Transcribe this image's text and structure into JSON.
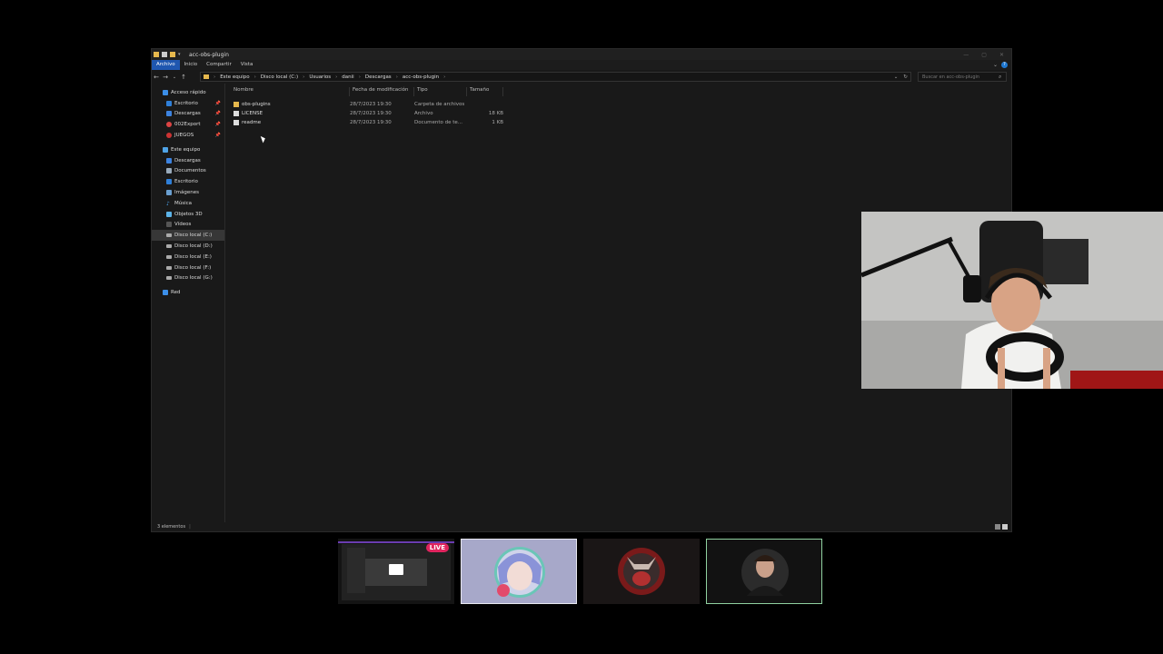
{
  "window": {
    "title": "acc-obs-plugin"
  },
  "ribbon": {
    "tabs": [
      "Archivo",
      "Inicio",
      "Compartir",
      "Vista"
    ]
  },
  "address": {
    "crumbs": [
      "Este equipo",
      "Disco local (C:)",
      "Usuarios",
      "danii",
      "Descargas",
      "acc-obs-plugin"
    ],
    "search_placeholder": "Buscar en acc-obs-plugin"
  },
  "sidebar": {
    "quick_access": "Acceso rápido",
    "quick_items": [
      "Escritorio",
      "Descargas",
      "002Export",
      "JUEGOS"
    ],
    "this_pc": "Este equipo",
    "pc_items": [
      "Descargas",
      "Documentos",
      "Escritorio",
      "Imágenes",
      "Música",
      "Objetos 3D",
      "Vídeos",
      "Disco local (C:)",
      "Disco local (D:)",
      "Disco local (E:)",
      "Disco local (F:)",
      "Disco local (G:)"
    ],
    "network": "Red",
    "selected": "Disco local (C:)"
  },
  "columns": [
    "Nombre",
    "Fecha de modificación",
    "Tipo",
    "Tamaño"
  ],
  "files": [
    {
      "name": "obs-plugins",
      "date": "28/7/2023 19:30",
      "type": "Carpeta de archivos",
      "size": ""
    },
    {
      "name": "LICENSE",
      "date": "28/7/2023 19:30",
      "type": "Archivo",
      "size": "18 KB"
    },
    {
      "name": "readme",
      "date": "28/7/2023 19:30",
      "type": "Documento de te...",
      "size": "1 KB"
    }
  ],
  "status": {
    "count_text": "3 elementos"
  },
  "stream": {
    "live_label": "LIVE"
  },
  "colors": {
    "accent": "#1f57b0",
    "folder": "#e6b84d",
    "live": "#e0245e",
    "selected_tile": "#8fd1a0"
  }
}
